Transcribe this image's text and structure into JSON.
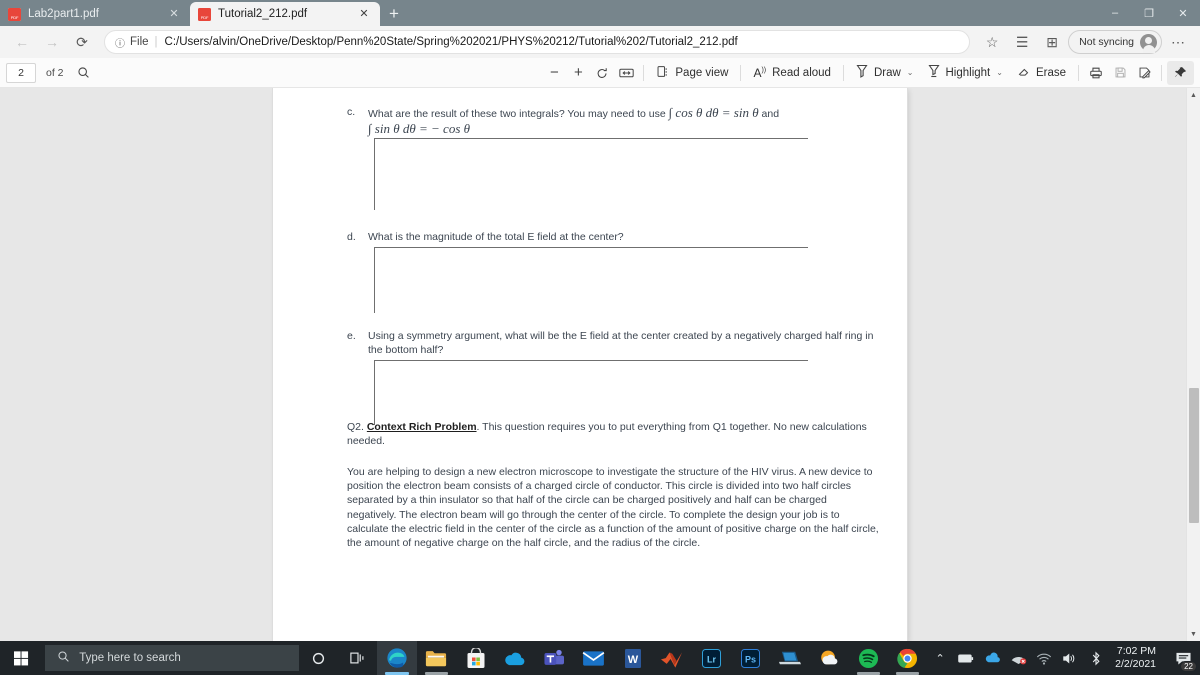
{
  "window": {
    "minimize_label": "–",
    "maximize_label": "❐",
    "close_label": "✕"
  },
  "tabs": [
    {
      "title": "Lab2part1.pdf",
      "close_label": "✕",
      "active": false
    },
    {
      "title": "Tutorial2_212.pdf",
      "close_label": "✕",
      "active": true
    }
  ],
  "newtab_label": "+",
  "nav": {
    "back_label": "←",
    "forward_label": "→",
    "refresh_label": "⟳",
    "info_icon": "ⓘ",
    "file_label": "File",
    "divider": "|",
    "url": "C:/Users/alvin/OneDrive/Desktop/Penn%20State/Spring%202021/PHYS%20212/Tutorial%202/Tutorial2_212.pdf",
    "favorite_label": "☆",
    "collections_label": "☰",
    "extensions_label": "⊞",
    "sync_text": "Not syncing",
    "settings_label": "⋯"
  },
  "pdf_toolbar": {
    "page_number": "2",
    "page_total": "of 2",
    "search_label": "⚲",
    "zoom_out_label": "−",
    "zoom_in_label": "+",
    "rotate_label": "↻",
    "fit_label": "↔",
    "page_view_label": "Page view",
    "read_aloud_label": "Read aloud",
    "read_aloud_icon": "A",
    "draw_label": "Draw",
    "highlight_label": "Highlight",
    "erase_label": "Erase",
    "print_label": "⎙",
    "save_label": "🖫",
    "save_as_label": "🗎",
    "pin_label": "📌",
    "chevron": "⌄"
  },
  "document": {
    "questions": [
      {
        "letter": "c.",
        "text_before": "What are the result of these two integrals? You may need to use ",
        "math_1": "∫ cos θ dθ = sin θ",
        "text_middle": " and",
        "math_2": "∫ sin θ dθ = − cos θ"
      },
      {
        "letter": "d.",
        "text_before": "What is the magnitude of the total E field at the center?"
      },
      {
        "letter": "e.",
        "text_before": "Using a symmetry argument, what will be the E field at the center created by a negatively charged half ring in the bottom half?"
      }
    ],
    "q2_prefix": "Q2. ",
    "q2_bold": "Context Rich Problem",
    "q2_rest": ". This question requires you to put everything from Q1 together. No new calculations needed.",
    "body_paragraph": "You are helping to design a new electron microscope to investigate the structure of the HIV virus. A new device to position the electron beam consists of a charged circle of conductor. This circle is divided into two half circles separated by a thin insulator so that half of the circle can be charged positively and half can be charged negatively. The electron beam will go through the center of the circle. To complete the design your job is to calculate the electric field in the center of the circle as a function of the amount of positive charge on the half circle, the amount of negative charge on the half circle, and the radius of the circle."
  },
  "scrollbar": {
    "up_label": "▲",
    "down_label": "▼"
  },
  "taskbar": {
    "search_placeholder": "Type here to search",
    "search_icon": "⚲",
    "cortana_label": "○",
    "taskview_label": "⧉",
    "apps": [
      {
        "name": "microsoft-edge",
        "active": true
      },
      {
        "name": "file-explorer",
        "active": false
      },
      {
        "name": "microsoft-store",
        "active": false
      },
      {
        "name": "onedrive",
        "active": false
      },
      {
        "name": "microsoft-teams",
        "active": false
      },
      {
        "name": "mail",
        "active": false
      },
      {
        "name": "microsoft-word",
        "active": false
      },
      {
        "name": "matlab",
        "active": false
      },
      {
        "name": "adobe-lightroom",
        "label": "Lr",
        "active": false
      },
      {
        "name": "adobe-photoshop",
        "label": "Ps",
        "active": false
      },
      {
        "name": "remote-desktop",
        "active": false
      },
      {
        "name": "weather",
        "active": false
      },
      {
        "name": "spotify",
        "active": false
      },
      {
        "name": "google-chrome",
        "active": false
      }
    ],
    "tray": {
      "show_hidden_label": "⌃",
      "battery_label": "▭",
      "onedrive_label": "☁",
      "network_alert_label": "⌁",
      "wifi_label": "◠",
      "volume_label": "🔊",
      "bluetooth_label": "ᛦ",
      "time": "7:02 PM",
      "date": "2/2/2021",
      "notification_count": "22"
    }
  },
  "colors": {
    "titlebar": "#77858c",
    "chrome": "#f3f3f3",
    "viewer_bg": "#e7e7e7",
    "taskbar": "#1f2428",
    "edge_blue": "#0f7ec1"
  }
}
